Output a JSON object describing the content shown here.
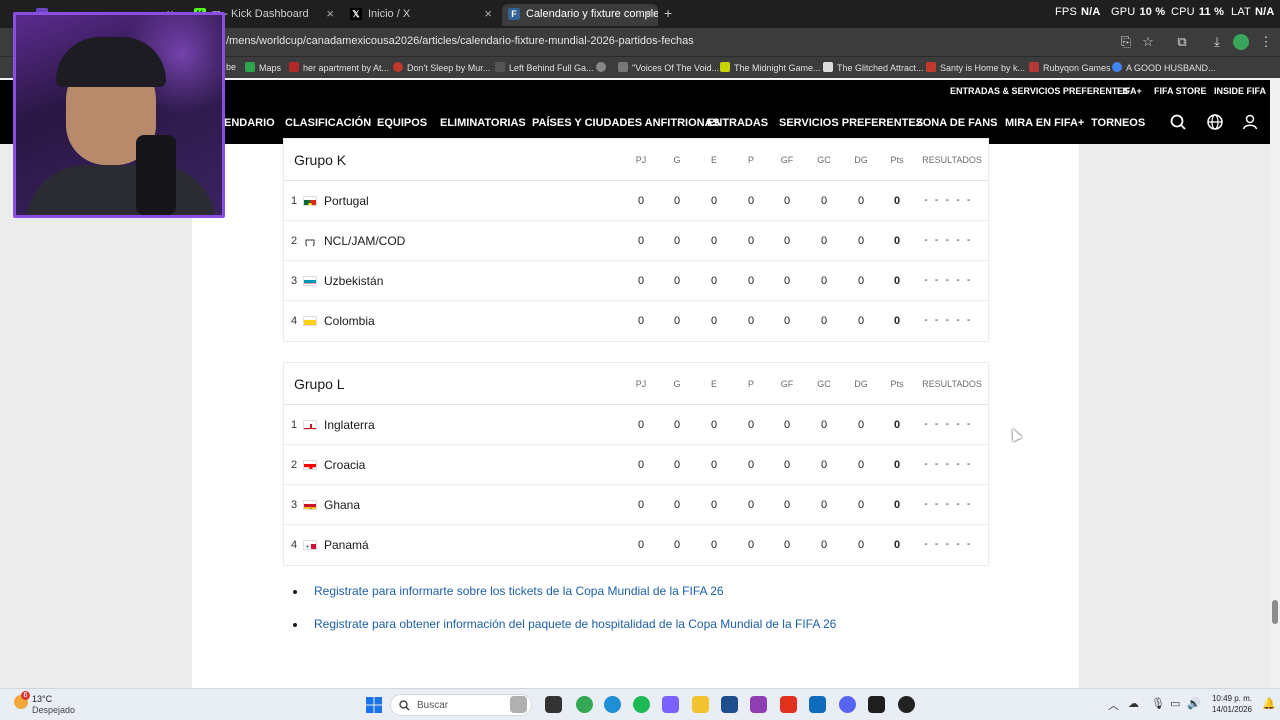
{
  "browser": {
    "tabs": [
      {
        "label": "",
        "icon": "purple-tab-icon",
        "active": false
      },
      {
        "label": "Kick Dashboard",
        "icon": "kick-icon",
        "active": false,
        "prefix": "m - "
      },
      {
        "label": "Inicio / X",
        "icon": "x-icon",
        "active": false
      },
      {
        "label": "Calendario y fixture completo d",
        "icon": "fifa-icon",
        "active": true
      }
    ],
    "url": "/mens/worldcup/canadamexicousa2026/articles/calendario-fixture-mundial-2026-partidos-fechas",
    "overlay": {
      "fps_label": "FPS",
      "fps": "N/A",
      "gpu_label": "GPU",
      "gpu": "10 %",
      "cpu_label": "CPU",
      "cpu": "11 %",
      "lat_label": "LAT",
      "lat": "N/A"
    },
    "bookmarks": [
      {
        "label": "be",
        "color": "#cc2b2b"
      },
      {
        "label": "Maps",
        "color": "#2ea44f"
      },
      {
        "label": "her apartment by At...",
        "color": "#b32929"
      },
      {
        "label": "Don't Sleep by Mur...",
        "color": "#c0392b"
      },
      {
        "label": "Left Behind Full Ga...",
        "color": "#555"
      },
      {
        "label": "",
        "color": "#888"
      },
      {
        "label": "\"Voices Of The Void...",
        "color": "#777"
      },
      {
        "label": "The Midnight Game...",
        "color": "#c7d400"
      },
      {
        "label": "The Glitched Attract...",
        "color": "#ddd"
      },
      {
        "label": "Santy is Home by k...",
        "color": "#c0392b"
      },
      {
        "label": "Rubyqon Games",
        "color": "#b33a3a"
      },
      {
        "label": "A GOOD HUSBAND...",
        "color": "#4285f4"
      }
    ]
  },
  "site": {
    "topnav": [
      "ENTRADAS & SERVICIOS PREFERENTES",
      "FIFA+",
      "FIFA STORE",
      "INSIDE FIFA"
    ],
    "mainnav": [
      "ENDARIO",
      "CLASIFICACIÓN",
      "EQUIPOS",
      "ELIMINATORIAS",
      "PAÍSES Y CIUDADES ANFITRIONAS",
      "ENTRADAS",
      "SERVICIOS PREFERENTES",
      "ZONA DE FANS",
      "MIRA EN FIFA+",
      "TORNEOS"
    ]
  },
  "columns": [
    "PJ",
    "G",
    "E",
    "P",
    "GF",
    "GC",
    "DG",
    "Pts",
    "RESULTADOS"
  ],
  "groups": [
    {
      "title": "Grupo K",
      "teams": [
        {
          "pos": "1",
          "name": "Portugal",
          "flag": "portugal",
          "stats": [
            "0",
            "0",
            "0",
            "0",
            "0",
            "0",
            "0",
            "0"
          ],
          "results": "- - - - -"
        },
        {
          "pos": "2",
          "name": "NCL/JAM/COD",
          "flag": "shield",
          "stats": [
            "0",
            "0",
            "0",
            "0",
            "0",
            "0",
            "0",
            "0"
          ],
          "results": "- - - - -"
        },
        {
          "pos": "3",
          "name": "Uzbekistán",
          "flag": "uzbekistan",
          "stats": [
            "0",
            "0",
            "0",
            "0",
            "0",
            "0",
            "0",
            "0"
          ],
          "results": "- - - - -"
        },
        {
          "pos": "4",
          "name": "Colombia",
          "flag": "colombia",
          "stats": [
            "0",
            "0",
            "0",
            "0",
            "0",
            "0",
            "0",
            "0"
          ],
          "results": "- - - - -"
        }
      ]
    },
    {
      "title": "Grupo L",
      "teams": [
        {
          "pos": "1",
          "name": "Inglaterra",
          "flag": "england",
          "stats": [
            "0",
            "0",
            "0",
            "0",
            "0",
            "0",
            "0",
            "0"
          ],
          "results": "- - - - -"
        },
        {
          "pos": "2",
          "name": "Croacia",
          "flag": "croatia",
          "stats": [
            "0",
            "0",
            "0",
            "0",
            "0",
            "0",
            "0",
            "0"
          ],
          "results": "- - - - -"
        },
        {
          "pos": "3",
          "name": "Ghana",
          "flag": "ghana",
          "stats": [
            "0",
            "0",
            "0",
            "0",
            "0",
            "0",
            "0",
            "0"
          ],
          "results": "- - - - -"
        },
        {
          "pos": "4",
          "name": "Panamá",
          "flag": "panama",
          "stats": [
            "0",
            "0",
            "0",
            "0",
            "0",
            "0",
            "0",
            "0"
          ],
          "results": "- - - - -"
        }
      ]
    }
  ],
  "links": [
    "Registrate para informarte sobre los tickets de la Copa Mundial de la FIFA 26",
    "Registrate para obtener información del paquete de hospitalidad de la Copa Mundial de la FIFA 26"
  ],
  "taskbar": {
    "weather_temp": "13°C",
    "weather_desc": "Despejado",
    "weather_badge": "6",
    "search_placeholder": "Buscar",
    "time": "10:49 p. m.",
    "date": "14/01/2026"
  }
}
